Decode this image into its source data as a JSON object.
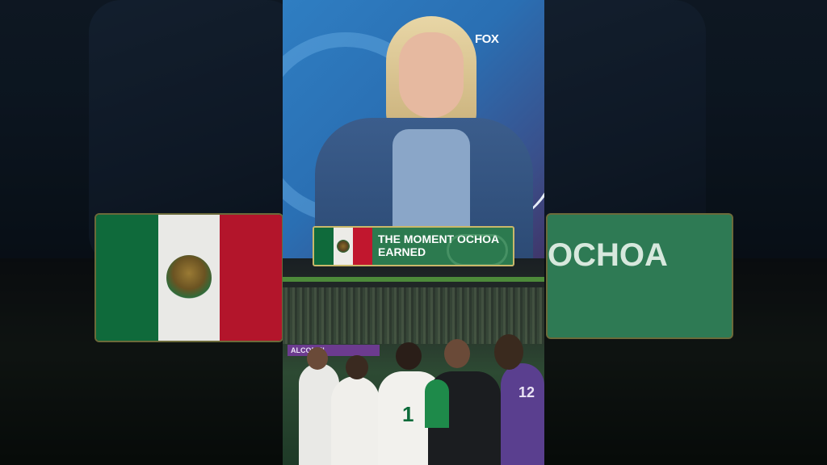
{
  "broadcaster_logo": "FOX",
  "lower_third": {
    "line1": "THE MOMENT OCHOA",
    "line2": "EARNED",
    "flag_icon": "mexico-flag-icon"
  },
  "background": {
    "blurred_banner_text": "OCHOA",
    "stadium_banner_text": "ALCOME!"
  },
  "players": {
    "jersey_number": "1",
    "keeper_number": "12"
  },
  "colors": {
    "banner_green": "#2c7a4f",
    "banner_border": "#c9b86a",
    "flag_green": "#0f6a3b",
    "flag_red": "#c1172e"
  }
}
